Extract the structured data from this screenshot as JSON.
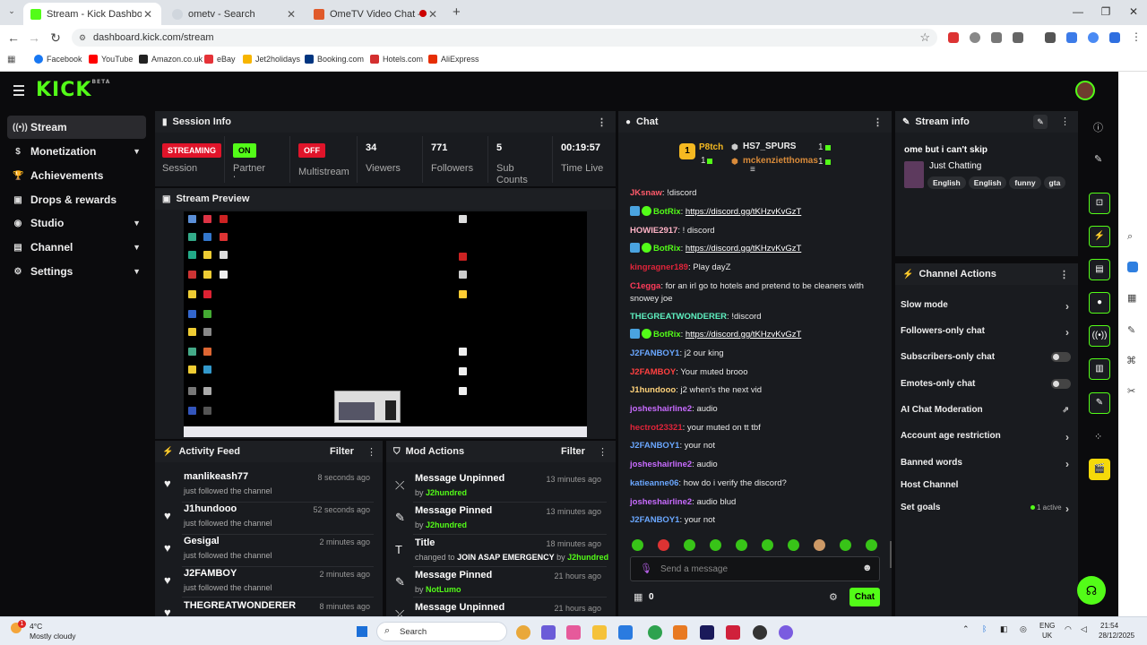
{
  "browser": {
    "tabs": [
      {
        "label": "Stream - Kick Dashboard",
        "active": true
      },
      {
        "label": "ometv - Search",
        "active": false
      },
      {
        "label": "OmeTV Video Chat — Ome",
        "active": false
      }
    ],
    "url": "dashboard.kick.com/stream",
    "bookmarks": [
      "Facebook",
      "YouTube",
      "Amazon.co.uk",
      "eBay",
      "Jet2holidays",
      "Booking.com",
      "Hotels.com",
      "AliExpress"
    ]
  },
  "app": {
    "logo": "KICK",
    "logo_sup": "BETA",
    "accent": "#53fc18"
  },
  "sidebar": {
    "items": [
      {
        "label": "Stream",
        "icon": "stream-icon"
      },
      {
        "label": "Monetization",
        "icon": "dollar-icon"
      },
      {
        "label": "Achievements",
        "icon": "trophy-icon"
      },
      {
        "label": "Drops & rewards",
        "icon": "gift-icon"
      },
      {
        "label": "Studio",
        "icon": "studio-icon"
      },
      {
        "label": "Channel",
        "icon": "channel-icon"
      },
      {
        "label": "Settings",
        "icon": "gear-icon"
      }
    ]
  },
  "session": {
    "title": "Session Info",
    "streaming_badge": "STREAMING",
    "streaming_label": "Session",
    "partner_badge": "ON",
    "partner_label": "Partner Income",
    "multistream_badge": "OFF",
    "multistream_label": "Multistream",
    "viewers": "34",
    "viewers_label": "Viewers",
    "followers": "771",
    "followers_label": "Followers",
    "subs": "5",
    "subs_label": "Sub Counts",
    "time": "00:19:57",
    "time_label": "Time Live"
  },
  "preview": {
    "title": "Stream Preview"
  },
  "activity": {
    "title": "Activity Feed",
    "filter": "Filter",
    "items": [
      {
        "name": "manlikeash77",
        "sub": "just followed the channel",
        "time": "8 seconds ago"
      },
      {
        "name": "J1hundooo",
        "sub": "just followed the channel",
        "time": "52 seconds ago"
      },
      {
        "name": "Gesigal",
        "sub": "just followed the channel",
        "time": "2 minutes ago"
      },
      {
        "name": "J2FAMBOY",
        "sub": "just followed the channel",
        "time": "2 minutes ago"
      },
      {
        "name": "THEGREATWONDERER",
        "sub": "",
        "time": "8 minutes ago"
      }
    ]
  },
  "mod": {
    "title": "Mod Actions",
    "filter": "Filter",
    "items": [
      {
        "name": "Message Unpinned",
        "by": "by",
        "user": "J2hundred",
        "time": "13 minutes ago"
      },
      {
        "name": "Message Pinned",
        "by": "by",
        "user": "J2hundred",
        "time": "13 minutes ago"
      },
      {
        "name": "Title",
        "by": "changed to",
        "value": "JOIN ASAP EMERGENCY",
        "by2": "by",
        "user": "J2hundred",
        "time": "18 minutes ago"
      },
      {
        "name": "Message Pinned",
        "by": "by",
        "user": "NotLumo",
        "time": "21 hours ago"
      },
      {
        "name": "Message Unpinned",
        "by": "",
        "user": "",
        "time": "21 hours ago"
      }
    ]
  },
  "chat": {
    "title": "Chat",
    "leaders": [
      {
        "rank": "1",
        "name": "P8tch",
        "count": "1"
      },
      {
        "name": "HS7_SPURS",
        "count": "1"
      },
      {
        "name": "mckenzietthomas",
        "count": "1"
      }
    ],
    "messages": [
      {
        "user": "JKsnaw",
        "color": "#ff5a6a",
        "text": "!discord"
      },
      {
        "user": "BotRix",
        "color": "#53fc18",
        "text": "https://discord.gg/tKHzvKvGzT",
        "bot": true
      },
      {
        "user": "HOWIE2917",
        "color": "#ffb3c6",
        "text": "! discord"
      },
      {
        "user": "BotRix",
        "color": "#53fc18",
        "text": "https://discord.gg/tKHzvKvGzT",
        "bot": true
      },
      {
        "user": "kingragner189",
        "color": "#e0243a",
        "text": "Play dayZ"
      },
      {
        "user": "C1egga",
        "color": "#ff3b5a",
        "text": "for an irl go to hotels and pretend to be cleaners with snowey joe"
      },
      {
        "user": "THEGREATWONDERER",
        "color": "#5ef0c0",
        "text": "!discord"
      },
      {
        "user": "BotRix",
        "color": "#53fc18",
        "text": "https://discord.gg/tKHzvKvGzT",
        "bot": true
      },
      {
        "user": "J2FANBOY1",
        "color": "#6aa7ff",
        "text": "j2 our king"
      },
      {
        "user": "J2FAMBOY",
        "color": "#ff4040",
        "text": "Your muted brooo"
      },
      {
        "user": "J1hundooo",
        "color": "#ffd27a",
        "text": "j2 when's the next vid"
      },
      {
        "user": "josheshairline2",
        "color": "#c86bff",
        "text": "audio"
      },
      {
        "user": "hectrot23321",
        "color": "#e0243a",
        "text": "your muted on tt tbf"
      },
      {
        "user": "J2FANBOY1",
        "color": "#6aa7ff",
        "text": "your not"
      },
      {
        "user": "josheshairline2",
        "color": "#c86bff",
        "text": "audio"
      },
      {
        "user": "katieanne06",
        "color": "#6aa7ff",
        "text": "how do i verify the discord?"
      },
      {
        "user": "josheshairline2",
        "color": "#c86bff",
        "text": "audio blud"
      },
      {
        "user": "J2FANBOY1",
        "color": "#6aa7ff",
        "text": "your not"
      }
    ],
    "placeholder": "Send a message",
    "points": "0",
    "send": "Chat"
  },
  "stream_info": {
    "title": "Stream info",
    "stream_title": "ome but i can't skip",
    "category": "Just Chatting",
    "tags": [
      "English",
      "English",
      "funny",
      "gta"
    ]
  },
  "channel_actions": {
    "title": "Channel Actions",
    "items": [
      {
        "label": "Slow mode",
        "control": "chevron"
      },
      {
        "label": "Followers-only chat",
        "control": "chevron"
      },
      {
        "label": "Subscribers-only chat",
        "control": "toggle"
      },
      {
        "label": "Emotes-only chat",
        "control": "toggle"
      },
      {
        "label": "AI Chat Moderation",
        "control": "external"
      },
      {
        "label": "Account age restriction",
        "control": "chevron"
      },
      {
        "label": "Banned words",
        "control": "chevron"
      },
      {
        "label": "Host Channel",
        "control": "none"
      },
      {
        "label": "Set goals",
        "control": "chevron",
        "status": "1 active"
      }
    ]
  },
  "taskbar": {
    "weather_temp": "4°C",
    "weather_desc": "Mostly cloudy",
    "search": "Search",
    "lang": "ENG",
    "region": "UK",
    "time": "21:54",
    "date": "28/12/2025",
    "notif": "1"
  }
}
